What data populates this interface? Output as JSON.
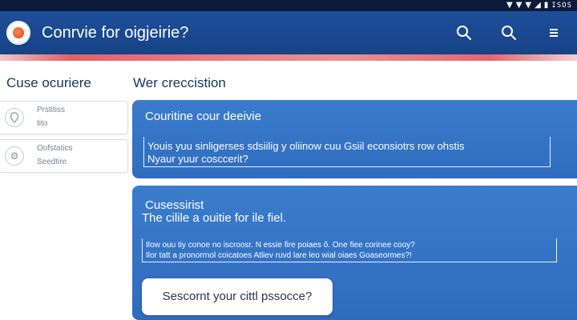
{
  "status_bar": {
    "indicators": [
      "wifi-icon",
      "wifi-icon",
      "signal-icon",
      "signal-icon",
      "battery-icon"
    ],
    "text": "ISOS"
  },
  "app_bar": {
    "title": "Conrvie for oigjeirie?",
    "logo": "app-logo-icon",
    "actions": [
      "search-icon",
      "search-icon",
      "menu-icon"
    ]
  },
  "sidebar": {
    "title": "Cuse ocuriere",
    "items": [
      {
        "icon": "location-pin-icon",
        "line1": "Prstitiss",
        "line2": "tito"
      },
      {
        "icon": "gear-icon",
        "line1": "Oofstatics",
        "line2": "Seedtire"
      }
    ]
  },
  "main": {
    "title": "Wer creccistion",
    "card1": {
      "heading": "Couritine cour deeivie",
      "line1": "Youis yuu sinligerses sdsiilig y oliinow cuu Gsiil econsiotrs row ohstis",
      "line2": "Nyaur yuur cosccerit?"
    },
    "card2": {
      "heading": "Cusessirist",
      "subheading": "The cilile a ouitie for ile fiel.",
      "line1": "Ilow ouu tiy conoe no iscroosr. N essie fire poiaes ô. One fiee corinee cooy?",
      "line2": "Ilor tatt a pronorrnol coicatoes Atliev ruvd lare leo wial oiaes Goaseormes?!",
      "search_placeholder": "Sescornt your cittl pssocce?"
    }
  },
  "colors": {
    "app_bar": "#1d4f9a",
    "card": "#3b7ccc",
    "accent_rule": "#e3606a",
    "status_bar": "#0b1a3a"
  }
}
